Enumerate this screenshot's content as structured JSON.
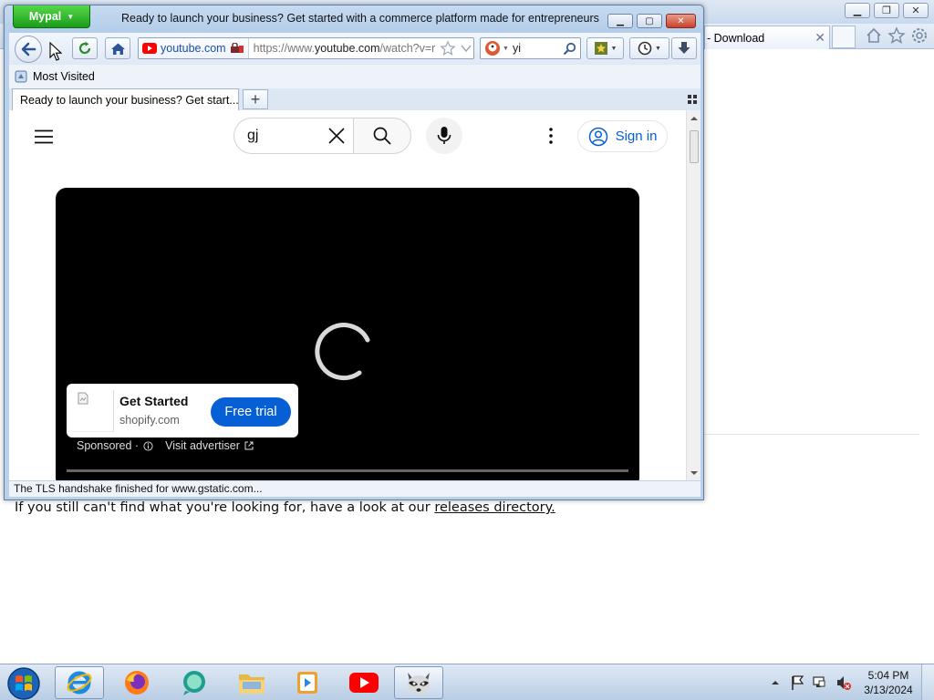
{
  "background_window": {
    "tab_title": "- Download",
    "tab_close": "✕",
    "body_text": "If you still can't find what you're looking for, have a look at our",
    "body_link": "releases directory."
  },
  "window": {
    "app_menu_label": "Mypal",
    "title": "Ready to launch your business? Get started with a commerce platform made for entrepreneurs"
  },
  "toolbar": {
    "identity_host": "youtube.com",
    "url_prefix": "https://www.",
    "url_domain": "youtube.com",
    "url_rest": "/watch?v=r",
    "search_value": "yi"
  },
  "bookmarks": {
    "items": [
      {
        "label": "Most Visited"
      }
    ]
  },
  "tabs": [
    {
      "label": "Ready to launch your business? Get start..."
    }
  ],
  "youtube": {
    "search_value": "gj",
    "signin_label": "Sign in",
    "ad": {
      "title": "Get Started",
      "domain": "shopify.com",
      "cta": "Free trial",
      "sponsored": "Sponsored ·",
      "visit": "Visit advertiser"
    }
  },
  "status_text": "The TLS handshake finished for www.gstatic.com...",
  "taskbar": {
    "clock_time": "5:04 PM",
    "clock_date": "3/13/2024"
  },
  "colors": {
    "youtube_red": "#ff0000",
    "youtube_blue": "#065fd4",
    "app_menu_green": "#2eb82b"
  }
}
